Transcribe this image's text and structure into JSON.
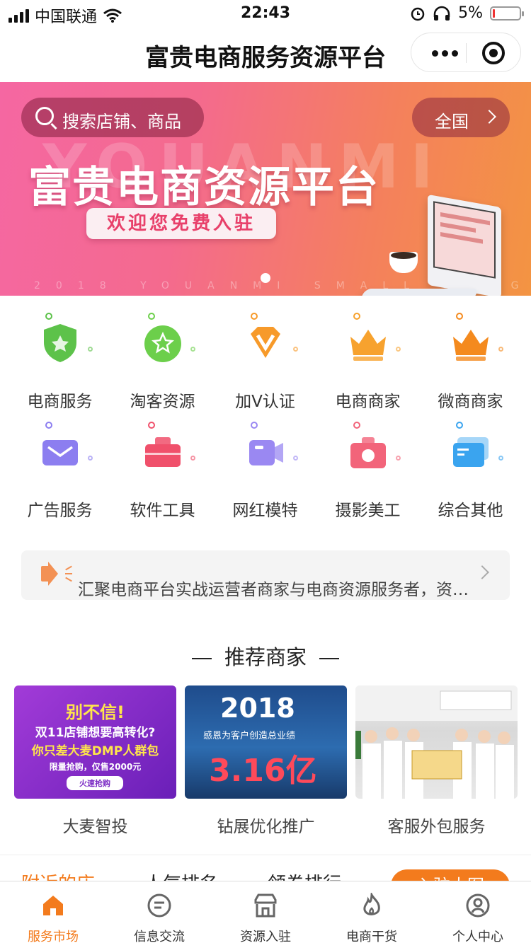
{
  "status_bar": {
    "carrier": "中国联通",
    "time": "22:43",
    "battery": "5%"
  },
  "nav": {
    "title": "富贵电商服务资源平台"
  },
  "banner": {
    "search_placeholder": "搜索店铺、商品",
    "region": "全国",
    "ghost_text": "YOUANMI",
    "headline": "富贵电商资源平台",
    "subline": "欢迎您免费入驻",
    "footer_text": "2018 YOUANMI SMALL PROGRAM",
    "active_slide": 1,
    "slide_count": 1
  },
  "categories": [
    {
      "label": "电商服务",
      "icon": "shield-star-icon",
      "color": "#5dc24a"
    },
    {
      "label": "淘客资源",
      "icon": "star-circle-icon",
      "color": "#6ccf4b"
    },
    {
      "label": "加V认证",
      "icon": "diamond-v-icon",
      "color": "#f79a2a"
    },
    {
      "label": "电商商家",
      "icon": "crown-icon",
      "color": "#f7a22e"
    },
    {
      "label": "微商商家",
      "icon": "crown-icon",
      "color": "#f48a1e"
    },
    {
      "label": "广告服务",
      "icon": "mail-icon",
      "color": "#8c7ef0"
    },
    {
      "label": "软件工具",
      "icon": "toolbox-icon",
      "color": "#f0506b"
    },
    {
      "label": "网红模特",
      "icon": "video-camera-icon",
      "color": "#9a88f2"
    },
    {
      "label": "摄影美工",
      "icon": "camera-icon",
      "color": "#f2647a"
    },
    {
      "label": "综合其他",
      "icon": "cards-icon",
      "color": "#3aa4ef"
    }
  ],
  "notice": {
    "text": "汇聚电商平台实战运营者商家与电商资源服务者，资…"
  },
  "recommended": {
    "title": "推荐商家",
    "items": [
      {
        "caption": "大麦智投",
        "img_lines": [
          "别不信!",
          "双11店铺想要高转化?",
          "你只差大麦DMP人群包",
          "限量抢购，仅售2000元",
          "火速抢购"
        ]
      },
      {
        "caption": "钻展优化推广",
        "img_lines": [
          "2018",
          "感恩为客户创造总业绩",
          "3.16亿"
        ]
      },
      {
        "caption": "客服外包服务",
        "img_lines": []
      }
    ]
  },
  "sub_tabs": {
    "items": [
      "附近的店",
      "人气排名",
      "领券排行"
    ],
    "active": 0,
    "join_label": "入驻大图"
  },
  "tab_bar": {
    "active": 0,
    "items": [
      {
        "label": "服务市场",
        "icon": "home-icon"
      },
      {
        "label": "信息交流",
        "icon": "chat-icon"
      },
      {
        "label": "资源入驻",
        "icon": "store-icon"
      },
      {
        "label": "电商干货",
        "icon": "fire-icon"
      },
      {
        "label": "个人中心",
        "icon": "user-icon"
      }
    ]
  },
  "colors": {
    "accent": "#f37b1d",
    "banner_start": "#f567a2",
    "banner_end": "#f39442"
  }
}
